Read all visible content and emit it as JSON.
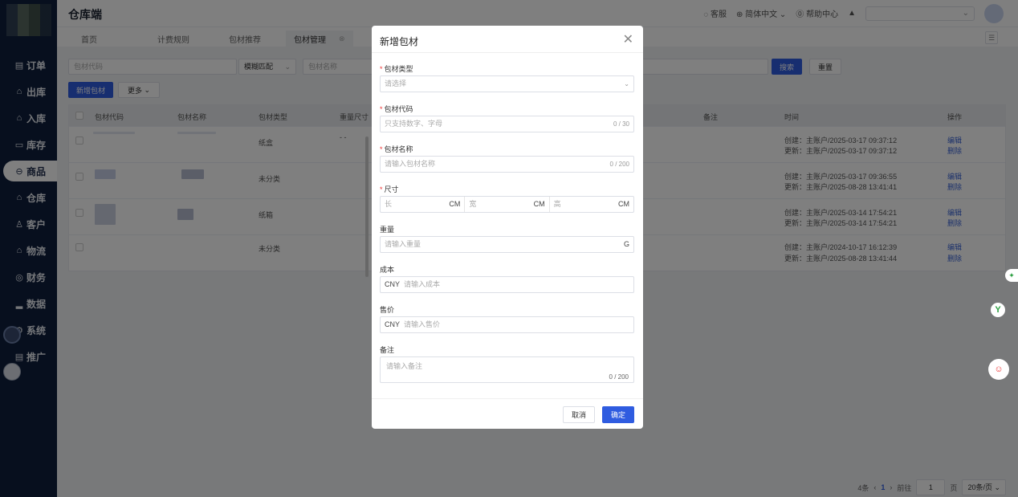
{
  "header": {
    "app_title": "仓库端",
    "customer_service": "客服",
    "language": "简体中文",
    "help_center": "帮助中心"
  },
  "sidebar": {
    "items": [
      {
        "label": "订单",
        "icon": "document-icon"
      },
      {
        "label": "出库",
        "icon": "box-out-icon"
      },
      {
        "label": "入库",
        "icon": "box-in-icon"
      },
      {
        "label": "库存",
        "icon": "inventory-icon"
      },
      {
        "label": "商品",
        "icon": "bag-icon"
      },
      {
        "label": "仓库",
        "icon": "warehouse-icon"
      },
      {
        "label": "客户",
        "icon": "user-icon"
      },
      {
        "label": "物流",
        "icon": "truck-icon"
      },
      {
        "label": "财务",
        "icon": "finance-icon"
      },
      {
        "label": "数据",
        "icon": "chart-icon"
      },
      {
        "label": "系统",
        "icon": "gear-icon"
      },
      {
        "label": "推广",
        "icon": "promote-icon"
      }
    ],
    "active_index": 4
  },
  "tabs": [
    {
      "label": "首页"
    },
    {
      "label": "计费规则"
    },
    {
      "label": "包材推荐"
    },
    {
      "label": "包材管理",
      "active": true
    }
  ],
  "search": {
    "code_placeholder": "包材代码",
    "match_mode": "模糊匹配",
    "name_placeholder": "包材名称",
    "search_button": "搜索",
    "reset_button": "重置",
    "add_button": "新增包材",
    "more_button": "更多"
  },
  "table": {
    "headers": [
      "包材代码",
      "包材名称",
      "包材类型",
      "重量尺寸",
      "备注",
      "时间",
      "操作"
    ],
    "rows": [
      {
        "type": "纸盒",
        "size": "- -",
        "created": "创建：主账户/2025-03-17 09:37:12",
        "updated": "更新：主账户/2025-03-17 09:37:12"
      },
      {
        "type": "未分类",
        "size": "",
        "created": "创建：主账户/2025-03-17 09:36:55",
        "updated": "更新：主账户/2025-08-28 13:41:41"
      },
      {
        "type": "纸箱",
        "size": "",
        "created": "创建：主账户/2025-03-14 17:54:21",
        "updated": "更新：主账户/2025-03-14 17:54:21"
      },
      {
        "type": "未分类",
        "size": "",
        "created": "创建：主账户/2024-10-17 16:12:39",
        "updated": "更新：主账户/2025-08-28 13:41:44"
      }
    ],
    "edit_label": "编辑",
    "delete_label": "删除"
  },
  "pagination": {
    "total": "4条",
    "current": "1",
    "goto_label": "前往",
    "goto_value": "1",
    "page_unit": "页",
    "page_size": "20条/页"
  },
  "modal": {
    "title": "新增包材",
    "type_label": "包材类型",
    "type_placeholder": "请选择",
    "code_label": "包材代码",
    "code_placeholder": "只支持数字、字母",
    "code_count": "0 / 30",
    "name_label": "包材名称",
    "name_placeholder": "请输入包材名称",
    "name_count": "0 / 200",
    "size_label": "尺寸",
    "length_placeholder": "长",
    "width_placeholder": "宽",
    "height_placeholder": "高",
    "size_unit": "CM",
    "weight_label": "重量",
    "weight_placeholder": "请输入重量",
    "weight_unit": "G",
    "cost_label": "成本",
    "cost_currency": "CNY",
    "cost_placeholder": "请输入成本",
    "price_label": "售价",
    "price_currency": "CNY",
    "price_placeholder": "请输入售价",
    "remark_label": "备注",
    "remark_placeholder": "请输入备注",
    "remark_count": "0 / 200",
    "cancel_button": "取消",
    "confirm_button": "确定"
  }
}
